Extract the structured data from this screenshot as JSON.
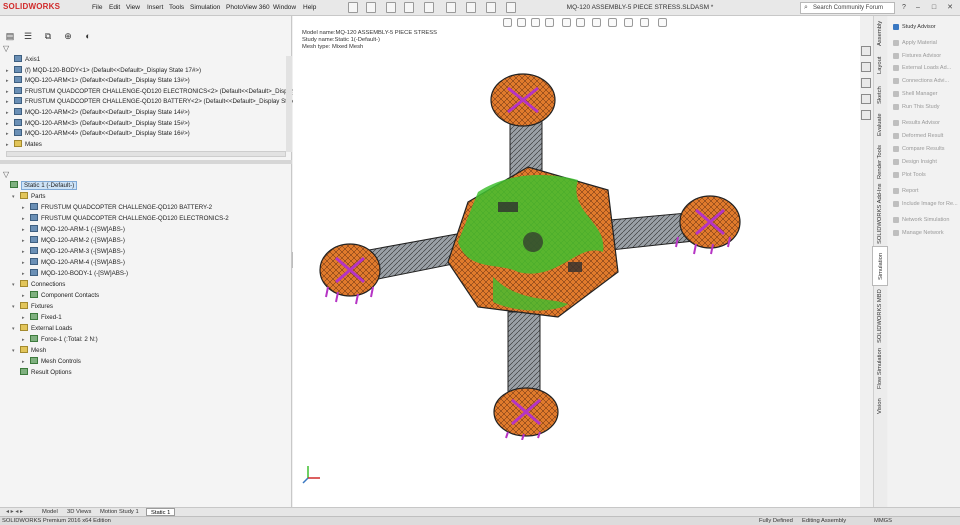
{
  "app": {
    "logo": "SOLIDWORKS",
    "menu": [
      "File",
      "Edit",
      "View",
      "Insert",
      "Tools",
      "Simulation",
      "PhotoView 360",
      "Window",
      "Help"
    ],
    "document_title": "MQ-120 ASSEMBLY-5 PIECE STRESS.SLDASM *",
    "search_placeholder": "Search Community Forum"
  },
  "feature_tree": [
    {
      "label": "Axis1",
      "type": "axis"
    },
    {
      "label": "(f) MQD-120-BODY<1> (Default<<Default>_Display State 17#>)",
      "type": "part"
    },
    {
      "label": "MQD-120-ARM<1> (Default<<Default>_Display State 13#>)",
      "type": "part"
    },
    {
      "label": "FRUSTUM QUADCOPTER CHALLENGE-QD120 ELECTRONICS<2> (Default<<Default>_Display S",
      "type": "part"
    },
    {
      "label": "FRUSTUM QUADCOPTER CHALLENGE-QD120 BATTERY<2> (Default<<Default>_Display State",
      "type": "part"
    },
    {
      "label": "MQD-120-ARM<2> (Default<<Default>_Display State 14#>)",
      "type": "part"
    },
    {
      "label": "MQD-120-ARM<3> (Default<<Default>_Display State 15#>)",
      "type": "part"
    },
    {
      "label": "MQD-120-ARM<4> (Default<<Default>_Display State 16#>)",
      "type": "part"
    },
    {
      "label": "Mates",
      "type": "folder"
    }
  ],
  "study_tree": [
    {
      "label": "Static 1 (-Default-)",
      "indent": 0,
      "type": "sim"
    },
    {
      "label": "Parts",
      "indent": 1,
      "type": "folder"
    },
    {
      "label": "FRUSTUM QUADCOPTER CHALLENGE-QD120 BATTERY-2",
      "indent": 2,
      "type": "part"
    },
    {
      "label": "FRUSTUM QUADCOPTER CHALLENGE-QD120 ELECTRONICS-2",
      "indent": 2,
      "type": "part"
    },
    {
      "label": "MQD-120-ARM-1 (-[SW]ABS-)",
      "indent": 2,
      "type": "part"
    },
    {
      "label": "MQD-120-ARM-2 (-[SW]ABS-)",
      "indent": 2,
      "type": "part"
    },
    {
      "label": "MQD-120-ARM-3 (-[SW]ABS-)",
      "indent": 2,
      "type": "part"
    },
    {
      "label": "MQD-120-ARM-4 (-[SW]ABS-)",
      "indent": 2,
      "type": "part"
    },
    {
      "label": "MQD-120-BODY-1 (-[SW]ABS-)",
      "indent": 2,
      "type": "part"
    },
    {
      "label": "Connections",
      "indent": 1,
      "type": "folder"
    },
    {
      "label": "Component Contacts",
      "indent": 2,
      "type": "sim"
    },
    {
      "label": "Fixtures",
      "indent": 1,
      "type": "folder"
    },
    {
      "label": "Fixed-1",
      "indent": 2,
      "type": "sim"
    },
    {
      "label": "External Loads",
      "indent": 1,
      "type": "folder"
    },
    {
      "label": "Force-1 (:Total: 2 N:)",
      "indent": 2,
      "type": "sim"
    },
    {
      "label": "Mesh",
      "indent": 1,
      "type": "folder"
    },
    {
      "label": "Mesh Controls",
      "indent": 2,
      "type": "sim"
    },
    {
      "label": "Result Options",
      "indent": 1,
      "type": "sim"
    }
  ],
  "viewport": {
    "model_name": "Model name:MQ-120 ASSEMBLY-5 PIECE STRESS",
    "study_name": "Study name:Static 1(-Default-)",
    "mesh_type": "Mesh type: Mixed Mesh"
  },
  "vertical_tabs": [
    "Assembly",
    "Layout",
    "Sketch",
    "Evaluate",
    "Render Tools",
    "SOLIDWORKS Add-Ins",
    "Simulation",
    "SOLIDWORKS MBD",
    "Flow Simulation",
    "Vision"
  ],
  "study_advisor": [
    {
      "label": "Study Advisor",
      "active": true
    },
    {
      "label": "Apply Material",
      "active": false
    },
    {
      "label": "Fixtures Advisor",
      "active": false
    },
    {
      "label": "External Loads Ad...",
      "active": false
    },
    {
      "label": "Connections Advi...",
      "active": false
    },
    {
      "label": "Shell Manager",
      "active": false
    },
    {
      "label": "Run This Study",
      "active": false
    },
    {
      "label": "Results Advisor",
      "active": false
    },
    {
      "label": "Deformed Result",
      "active": false
    },
    {
      "label": "Compare Results",
      "active": false
    },
    {
      "label": "Design Insight",
      "active": false
    },
    {
      "label": "Plot Tools",
      "active": false
    },
    {
      "label": "Report",
      "active": false
    },
    {
      "label": "Include Image for Re...",
      "active": false
    },
    {
      "label": "Network Simulation",
      "active": false
    },
    {
      "label": "Manage Network",
      "active": false
    }
  ],
  "bottom_tabs": [
    {
      "label": "Model",
      "active": false
    },
    {
      "label": "3D Views",
      "active": false
    },
    {
      "label": "Motion Study 1",
      "active": false
    },
    {
      "label": "Static 1",
      "active": true
    }
  ],
  "status": {
    "edition": "SOLIDWORKS Premium 2016 x64 Edition",
    "state": "Fully Defined",
    "mode": "Editing Assembly",
    "units": "MMGS"
  },
  "colors": {
    "mesh_orange": "#e07a2c",
    "contact_green": "#3fbf2f",
    "fixture_magenta": "#b534c4",
    "dark": "#2f2f2f",
    "accent_blue": "#3a78c2"
  }
}
